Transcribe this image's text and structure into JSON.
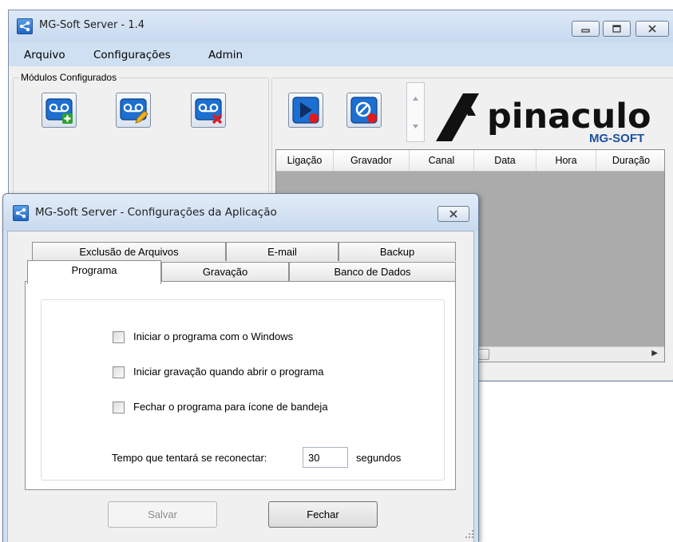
{
  "main_window": {
    "title": "MG-Soft Server - 1.4",
    "menu": [
      "Arquivo",
      "Configurações",
      "Admin"
    ],
    "modules_group_label": "Módulos Configurados",
    "module_buttons": [
      {
        "name": "add-module-icon"
      },
      {
        "name": "edit-module-icon"
      },
      {
        "name": "remove-module-icon"
      }
    ],
    "record_buttons": [
      {
        "name": "start-record-icon"
      },
      {
        "name": "stop-record-icon"
      }
    ],
    "logo": {
      "brand": "pinaculo",
      "subtitle": "MG-SOFT",
      "accent_color": "#1e4fa3"
    },
    "grid_columns": [
      "Ligação",
      "Gravador",
      "Canal",
      "Data",
      "Hora",
      "Duração"
    ]
  },
  "dialog": {
    "title": "MG-Soft Server - Configurações da Aplicação",
    "tabs_back": [
      "Exclusão de Arquivos",
      "E-mail",
      "Backup"
    ],
    "tabs_front": [
      "Programa",
      "Gravação",
      "Banco de Dados"
    ],
    "selected_tab": "Programa",
    "options": [
      {
        "label": "Iniciar o programa com o Windows",
        "checked": false
      },
      {
        "label": "Iniciar gravação quando abrir o programa",
        "checked": false
      },
      {
        "label": "Fechar o programa para ícone de bandeja",
        "checked": false
      }
    ],
    "retry": {
      "label": "Tempo que tentará se reconectar:",
      "value": "30",
      "unit": "segundos"
    },
    "buttons": {
      "save": "Salvar",
      "close": "Fechar"
    }
  }
}
